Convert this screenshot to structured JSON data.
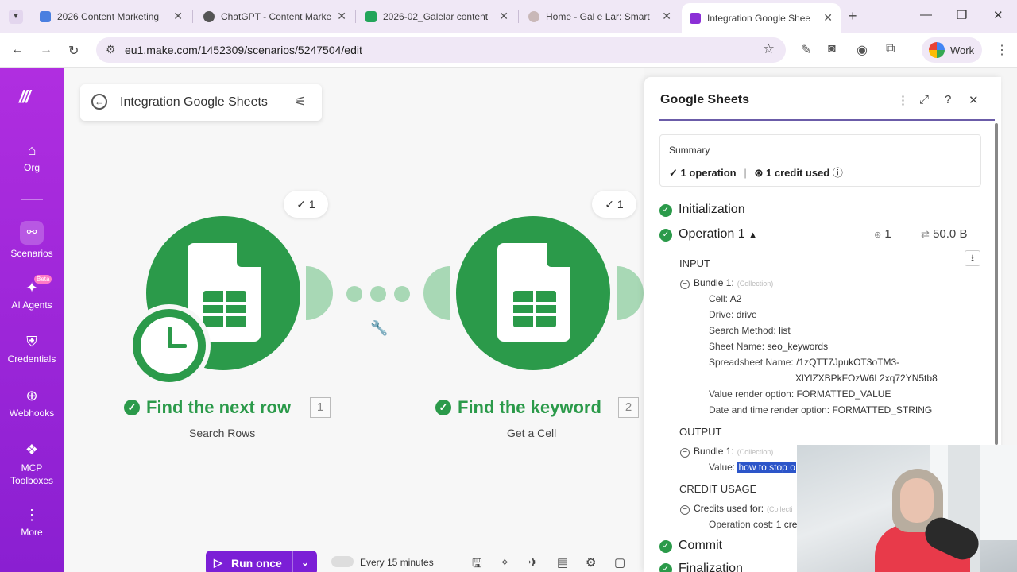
{
  "browser": {
    "tabs": [
      {
        "title": "2026 Content Marketing",
        "fav_color": "#4a7fe0"
      },
      {
        "title": "ChatGPT - Content Marke",
        "fav_color": "#555555"
      },
      {
        "title": "2026-02_Galelar content",
        "fav_color": "#23a55a"
      },
      {
        "title": "Home - Gal e Lar: Smart",
        "fav_color": "#c9b8b8"
      },
      {
        "title": "Integration Google Shee",
        "fav_color": "#8b2fd6"
      }
    ],
    "url": "eu1.make.com/1452309/scenarios/5247504/edit",
    "profile_label": "Work"
  },
  "sidebar": {
    "items": [
      {
        "label": "Org",
        "icon": "home-icon"
      },
      {
        "label": "Scenarios",
        "icon": "share-icon"
      },
      {
        "label": "AI Agents",
        "icon": "sparkle-icon",
        "badge": "Beta"
      },
      {
        "label": "Credentials",
        "icon": "shield-icon"
      },
      {
        "label": "Webhooks",
        "icon": "globe-icon"
      },
      {
        "label": "MCP Toolboxes",
        "icon": "mcp-icon"
      },
      {
        "label": "More",
        "icon": "more-icon"
      }
    ]
  },
  "scenario": {
    "title": "Integration Google Sheets",
    "modules": [
      {
        "name": "Find the next row",
        "number": "1",
        "subtitle": "Search Rows",
        "ops": "1"
      },
      {
        "name": "Find the keyword",
        "number": "2",
        "subtitle": "Get a Cell",
        "ops": "1"
      }
    ],
    "run_label": "Run once",
    "schedule_label": "Every 15 minutes"
  },
  "panel": {
    "title": "Google Sheets",
    "summary_title": "Summary",
    "summary_ops": "1 operation",
    "summary_credits": "1 credit used",
    "steps": {
      "initialization": "Initialization",
      "operation": "Operation 1",
      "commit": "Commit",
      "finalization": "Finalization"
    },
    "op_credits": "1",
    "op_size": "50.0 B",
    "input_label": "INPUT",
    "output_label": "OUTPUT",
    "credit_usage_label": "CREDIT USAGE",
    "bundle_label": "Bundle 1:",
    "collection_label": "(Collection)",
    "input_fields": [
      {
        "k": "Cell:",
        "v": "A2"
      },
      {
        "k": "Drive:",
        "v": "drive"
      },
      {
        "k": "Search Method:",
        "v": "list"
      },
      {
        "k": "Sheet Name:",
        "v": "seo_keywords"
      },
      {
        "k": "Spreadsheet Name:",
        "v": "/1zQTT7JpukOT3oTM3-"
      },
      {
        "k": "",
        "v": "XlYlZXBPkFOzW6L2xq72YN5tb8"
      },
      {
        "k": "Value render option:",
        "v": "FORMATTED_VALUE"
      },
      {
        "k": "Date and time render option:",
        "v": "FORMATTED_STRING"
      }
    ],
    "output_value_key": "Value:",
    "output_value": "how to stop o",
    "credits_used_for": "Credits used for:",
    "credits_collection": "(Collecti",
    "operation_cost_key": "Operation cost:",
    "operation_cost_value": "1 cre"
  }
}
